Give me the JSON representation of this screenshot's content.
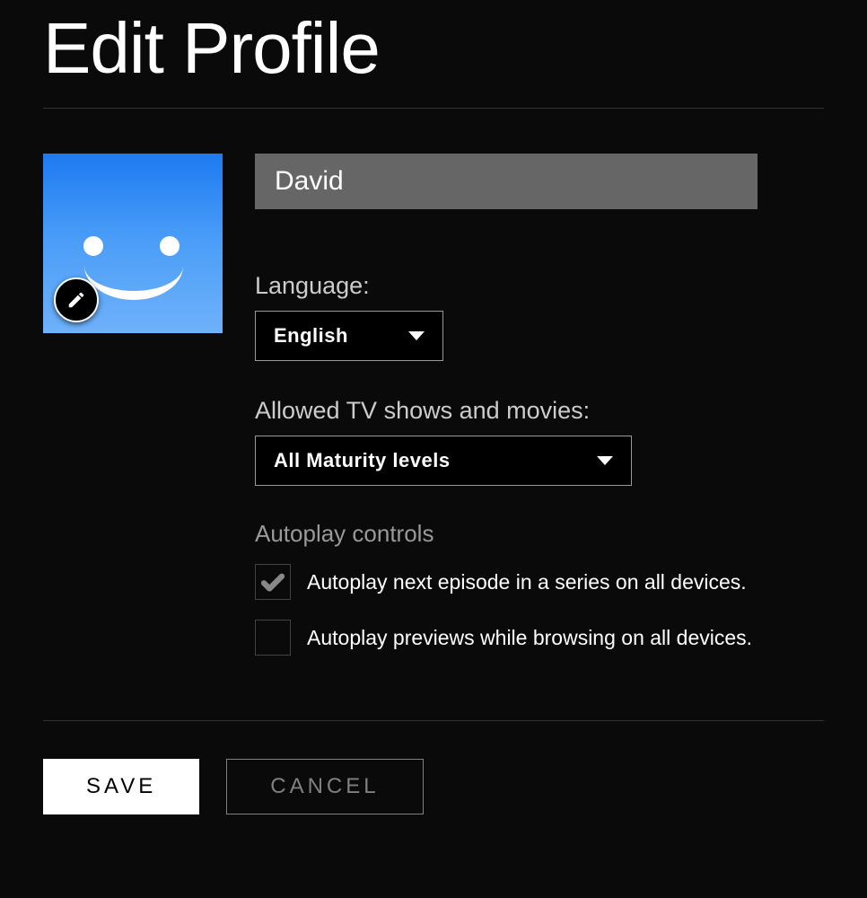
{
  "page": {
    "title": "Edit Profile"
  },
  "profile": {
    "name": "David",
    "avatar_edit_icon": "pencil-icon"
  },
  "language": {
    "label": "Language:",
    "selected": "English"
  },
  "maturity": {
    "label": "Allowed TV shows and movies:",
    "selected": "All Maturity levels"
  },
  "autoplay": {
    "heading": "Autoplay controls",
    "next_episode": {
      "label": "Autoplay next episode in a series on all devices.",
      "checked": true
    },
    "previews": {
      "label": "Autoplay previews while browsing on all devices.",
      "checked": false
    }
  },
  "buttons": {
    "save": "SAVE",
    "cancel": "CANCEL"
  }
}
